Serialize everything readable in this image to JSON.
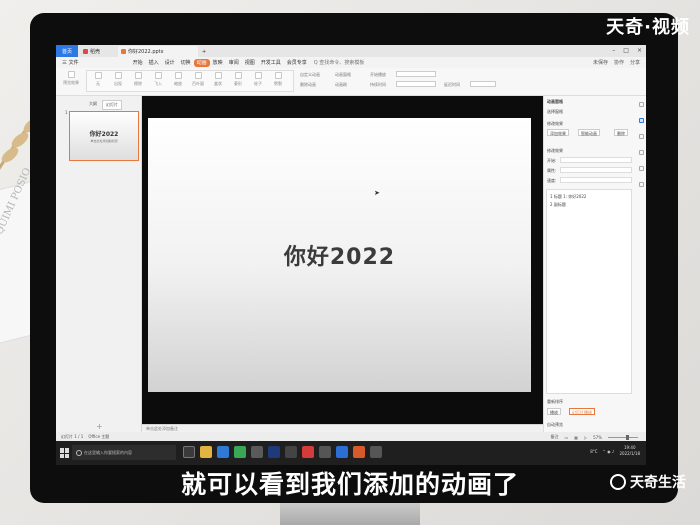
{
  "watermark": {
    "brand": "天奇·视频",
    "bottom_brand": "天奇生活"
  },
  "caption": "就可以看到我们添加的动画了",
  "titlebar": {
    "home_tab": "首页",
    "tab1": "稻壳",
    "tab2": "你好2022.pptx",
    "add_tab": "+"
  },
  "menubar": {
    "file": "三 文件",
    "items": [
      "开始",
      "插入",
      "设计",
      "切换",
      "动画",
      "放映",
      "审阅",
      "视图",
      "开发工具",
      "会员专享"
    ],
    "active_index": 4,
    "search": "Q 查找命令、搜索模板",
    "right": [
      "未保存",
      "协作",
      "分享"
    ]
  },
  "ribbon": {
    "preview": "预览效果",
    "effects": [
      "无",
      "出现",
      "擦除",
      "飞入",
      "缩放",
      "百叶窗",
      "盒状",
      "菱形",
      "轮子",
      "劈裂"
    ],
    "options": [
      "自定义动画",
      "删除动画",
      "动画窗格",
      "动画刷"
    ],
    "start_label": "开始播放",
    "duration_label": "持续时间",
    "delay_label": "延迟时间"
  },
  "left_pane": {
    "tab_outline": "大纲",
    "tab_slides": "幻灯片",
    "slide_number": "1",
    "thumb_title": "你好2022",
    "thumb_sub": "单击此处添加副标题"
  },
  "slide": {
    "title": "你好2022"
  },
  "notes_placeholder": "单击此处添加备注",
  "right_pane": {
    "header": "动画窗格",
    "select_pane": "选择窗格",
    "modify_effect": "修改效果",
    "add_effect": "添加效果",
    "smart_anim": "智能动画",
    "delete": "删除",
    "edit_effect": "修改效果",
    "start": "开始:",
    "property": "属性:",
    "speed": "速度:",
    "list_items": [
      "1  标题 1: 你好2022",
      "2  副标题"
    ],
    "reorder": "重新排序",
    "play": "播放",
    "slideshow": "幻灯片播放",
    "autopreview": "自动预览"
  },
  "statusbar": {
    "slide_info": "幻灯片 1 / 1",
    "theme": "Office 主题",
    "notes": "备注",
    "zoom": "57%"
  },
  "taskbar": {
    "search_placeholder": "在这里输入你要搜索的内容",
    "temp": "8°C",
    "time": "19:40",
    "date": "2022/1/18"
  }
}
